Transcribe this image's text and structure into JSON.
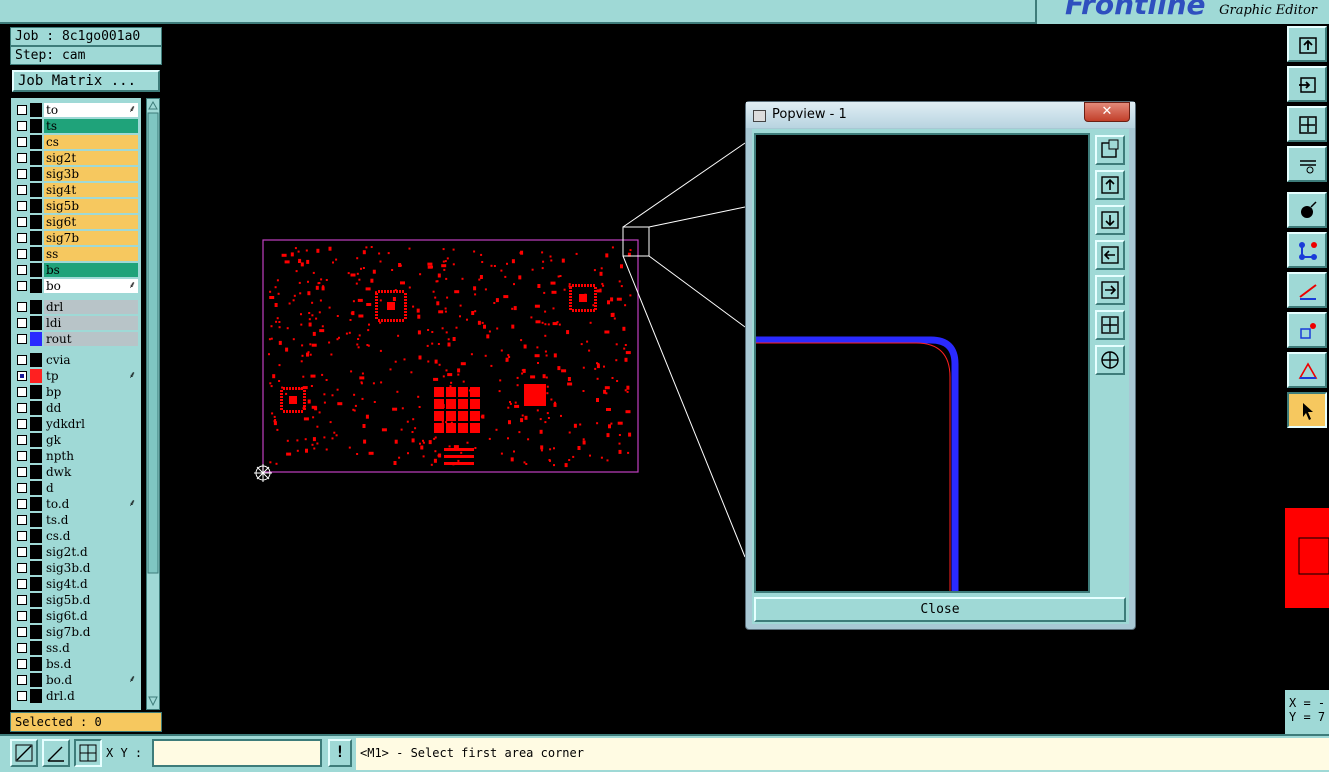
{
  "header": {
    "logo_text": "Frontline",
    "app_subtitle": "Graphic Editor"
  },
  "job_info": {
    "job": "Job : 8c1go001a0",
    "step": "Step: cam",
    "job_matrix_label": "Job Matrix ..."
  },
  "layers_group1": [
    {
      "name": "to",
      "color": "#ffffff",
      "mark": true
    },
    {
      "name": "ts",
      "color": "#1fa37a",
      "mark": false
    },
    {
      "name": "cs",
      "color": "#f6c85f",
      "mark": false
    },
    {
      "name": "sig2t",
      "color": "#f6c85f",
      "mark": false
    },
    {
      "name": "sig3b",
      "color": "#f6c85f",
      "mark": false
    },
    {
      "name": "sig4t",
      "color": "#f6c85f",
      "mark": false
    },
    {
      "name": "sig5b",
      "color": "#f6c85f",
      "mark": false
    },
    {
      "name": "sig6t",
      "color": "#f6c85f",
      "mark": false
    },
    {
      "name": "sig7b",
      "color": "#f6c85f",
      "mark": false
    },
    {
      "name": "ss",
      "color": "#f6c85f",
      "mark": false
    },
    {
      "name": "bs",
      "color": "#1fa37a",
      "mark": false
    },
    {
      "name": "bo",
      "color": "#ffffff",
      "mark": true
    }
  ],
  "layers_group2": [
    {
      "name": "drl",
      "color": "#b8c4c8"
    },
    {
      "name": "ldi",
      "color": "#b8c4c8"
    },
    {
      "name": "rout",
      "color": "#b8c4c8",
      "swatch": "#2a2aff"
    }
  ],
  "layers_group3": [
    {
      "name": "cvia",
      "swatch": "#000000"
    },
    {
      "name": "tp",
      "swatch": "#ff2020",
      "checked": true,
      "mark": true
    },
    {
      "name": "bp"
    },
    {
      "name": "dd"
    },
    {
      "name": "ydkdrl"
    },
    {
      "name": "gk"
    },
    {
      "name": "npth"
    },
    {
      "name": "dwk"
    },
    {
      "name": "d"
    },
    {
      "name": "to.d",
      "mark": true
    },
    {
      "name": "ts.d"
    },
    {
      "name": "cs.d"
    },
    {
      "name": "sig2t.d"
    },
    {
      "name": "sig3b.d"
    },
    {
      "name": "sig4t.d"
    },
    {
      "name": "sig5b.d"
    },
    {
      "name": "sig6t.d"
    },
    {
      "name": "sig7b.d"
    },
    {
      "name": "ss.d"
    },
    {
      "name": "bs.d"
    },
    {
      "name": "bo.d",
      "mark": true
    },
    {
      "name": "drl.d"
    }
  ],
  "selected_label": "Selected : 0",
  "bottom": {
    "xy_label": "X Y :",
    "xy_value": "",
    "warn_label": "!",
    "status_text": "<M1> - Select first area corner"
  },
  "coords": {
    "x_label": "X = -",
    "y_label": "Y = 7"
  },
  "popview": {
    "title": "Popview - 1",
    "close_x": "✕",
    "close_label": "Close"
  },
  "colors": {
    "panel": "#9fd9d6",
    "copper": "#ff0000",
    "profile": "#c040c0",
    "trace": "#2a2aff"
  }
}
